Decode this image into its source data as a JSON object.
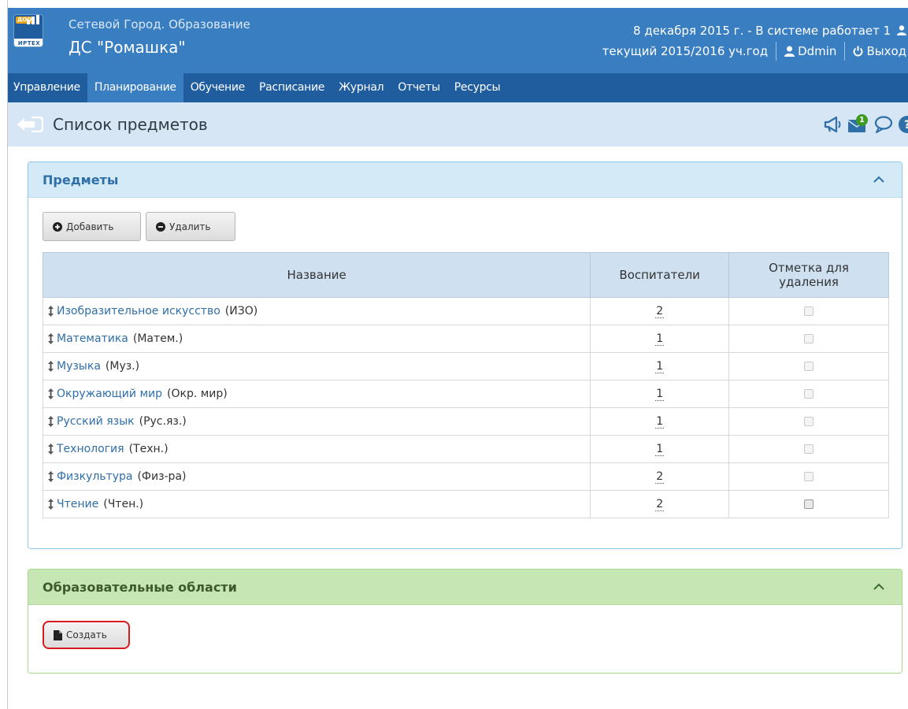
{
  "header": {
    "logo_badge": "ДОО",
    "logo_text": "ИРТЕХ",
    "app_name": "Сетевой Город. Образование",
    "org_name": "ДС \"Ромашка\"",
    "date_status": "8 декабря 2015 г. - В системе работает 1",
    "school_year": "текущий 2015/2016 уч.год",
    "user": "Ddmin",
    "logout": "Выход"
  },
  "nav": [
    "Управление",
    "Планирование",
    "Обучение",
    "Расписание",
    "Журнал",
    "Отчеты",
    "Ресурсы"
  ],
  "nav_active": "Планирование",
  "page_title": "Список предметов",
  "notifications": {
    "mail_count": "1"
  },
  "subjects_panel": {
    "title": "Предметы",
    "add_label": "Добавить",
    "delete_label": "Удалить",
    "columns": [
      "Название",
      "Воспитатели",
      "Отметка для удаления"
    ],
    "rows": [
      {
        "name": "Изобразительное искусство",
        "abbr": "(ИЗО)",
        "teachers": "2"
      },
      {
        "name": "Математика",
        "abbr": "(Матем.)",
        "teachers": "1"
      },
      {
        "name": "Музыка",
        "abbr": "(Муз.)",
        "teachers": "1"
      },
      {
        "name": "Окружающий мир",
        "abbr": "(Окр. мир)",
        "teachers": "1"
      },
      {
        "name": "Русский язык",
        "abbr": "(Рус.яз.)",
        "teachers": "1"
      },
      {
        "name": "Технология",
        "abbr": "(Техн.)",
        "teachers": "1"
      },
      {
        "name": "Физкультура",
        "abbr": "(Физ-ра)",
        "teachers": "2"
      },
      {
        "name": "Чтение",
        "abbr": "(Чтен.)",
        "teachers": "2"
      }
    ]
  },
  "areas_panel": {
    "title": "Образовательные области",
    "create_label": "Создать"
  },
  "colors": {
    "header": "#3a7ec2",
    "nav": "#1f5d9e",
    "title_bar": "#d6e6f5",
    "subjects_head": "#d4ebf7",
    "areas_head": "#c6e6b3",
    "highlight": "#d71920"
  }
}
